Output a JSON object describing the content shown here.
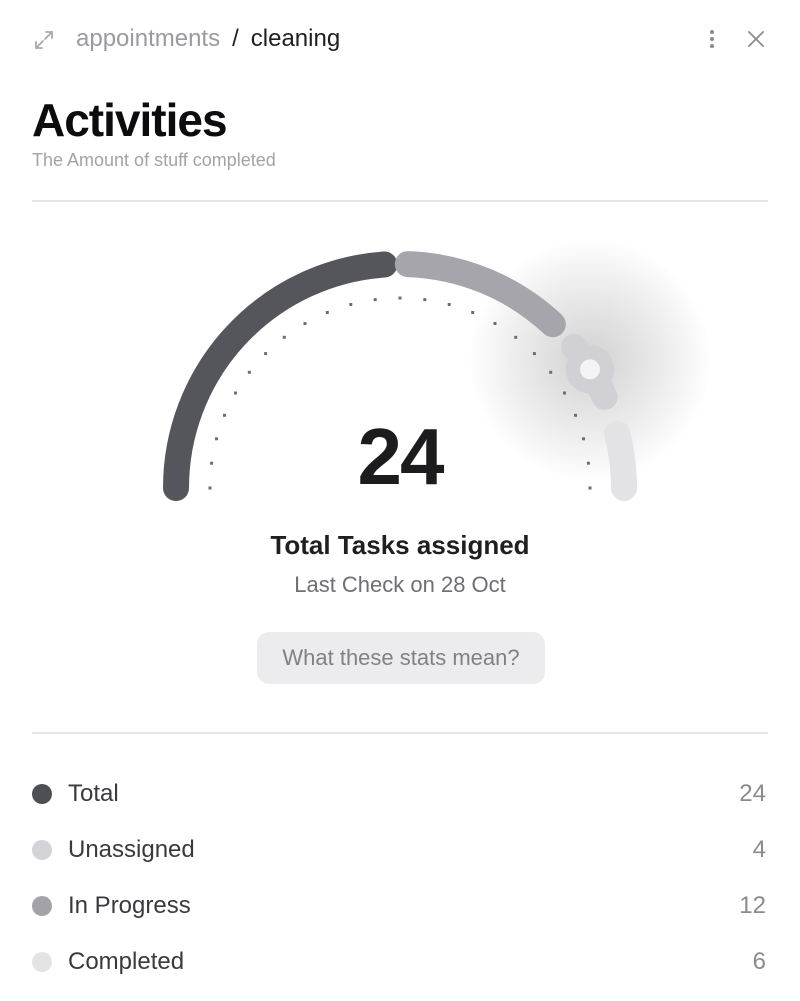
{
  "header": {
    "breadcrumb_parent": "appointments",
    "breadcrumb_separator": "/",
    "breadcrumb_current": "cleaning",
    "icons": {
      "expand": "expand-icon",
      "more": "more-vertical-icon",
      "close": "close-icon"
    }
  },
  "page": {
    "title": "Activities",
    "subtitle": "The Amount of stuff completed"
  },
  "gauge": {
    "total": "24",
    "caption": "Total Tasks assigned",
    "last_check": "Last Check on 28 Oct",
    "help_button_label": "What these stats mean?",
    "colors": {
      "total": "#55555c",
      "in_progress": "#a5a5ab",
      "unassigned": "#d0d0d5",
      "completed": "#e3e3e6",
      "ticks": "#6d6d73"
    }
  },
  "legend": [
    {
      "label": "Total",
      "value": "24",
      "color": "#4e4e55"
    },
    {
      "label": "Unassigned",
      "value": "4",
      "color": "#d3d3d8"
    },
    {
      "label": "In Progress",
      "value": "12",
      "color": "#a2a2a8"
    },
    {
      "label": "Completed",
      "value": "6",
      "color": "#e4e4e7"
    }
  ]
}
